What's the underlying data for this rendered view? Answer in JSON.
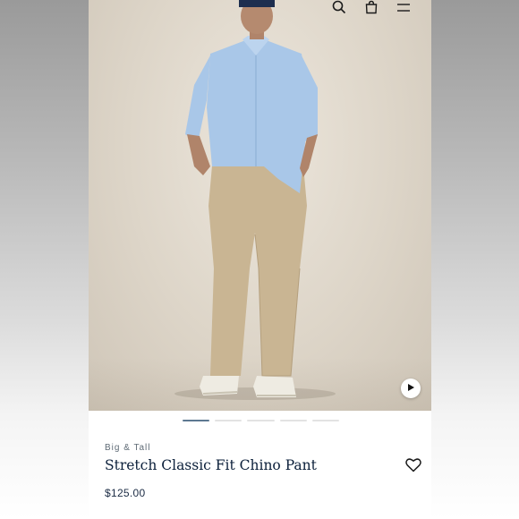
{
  "header": {
    "icons": [
      "search-icon",
      "shopping-bag-icon",
      "menu-icon"
    ]
  },
  "hero": {
    "video_icon": "play-icon",
    "carousel": {
      "count": 5,
      "active_index": 0
    }
  },
  "product": {
    "category": "Big & Tall",
    "name": "Stretch Classic Fit Chino Pant",
    "price": "$125.00",
    "wishlist_icon": "heart-icon"
  },
  "colors": {
    "title": "#0b1f3a",
    "carousel_active": "#5d7891",
    "carousel_inactive": "#e3e3e3"
  }
}
